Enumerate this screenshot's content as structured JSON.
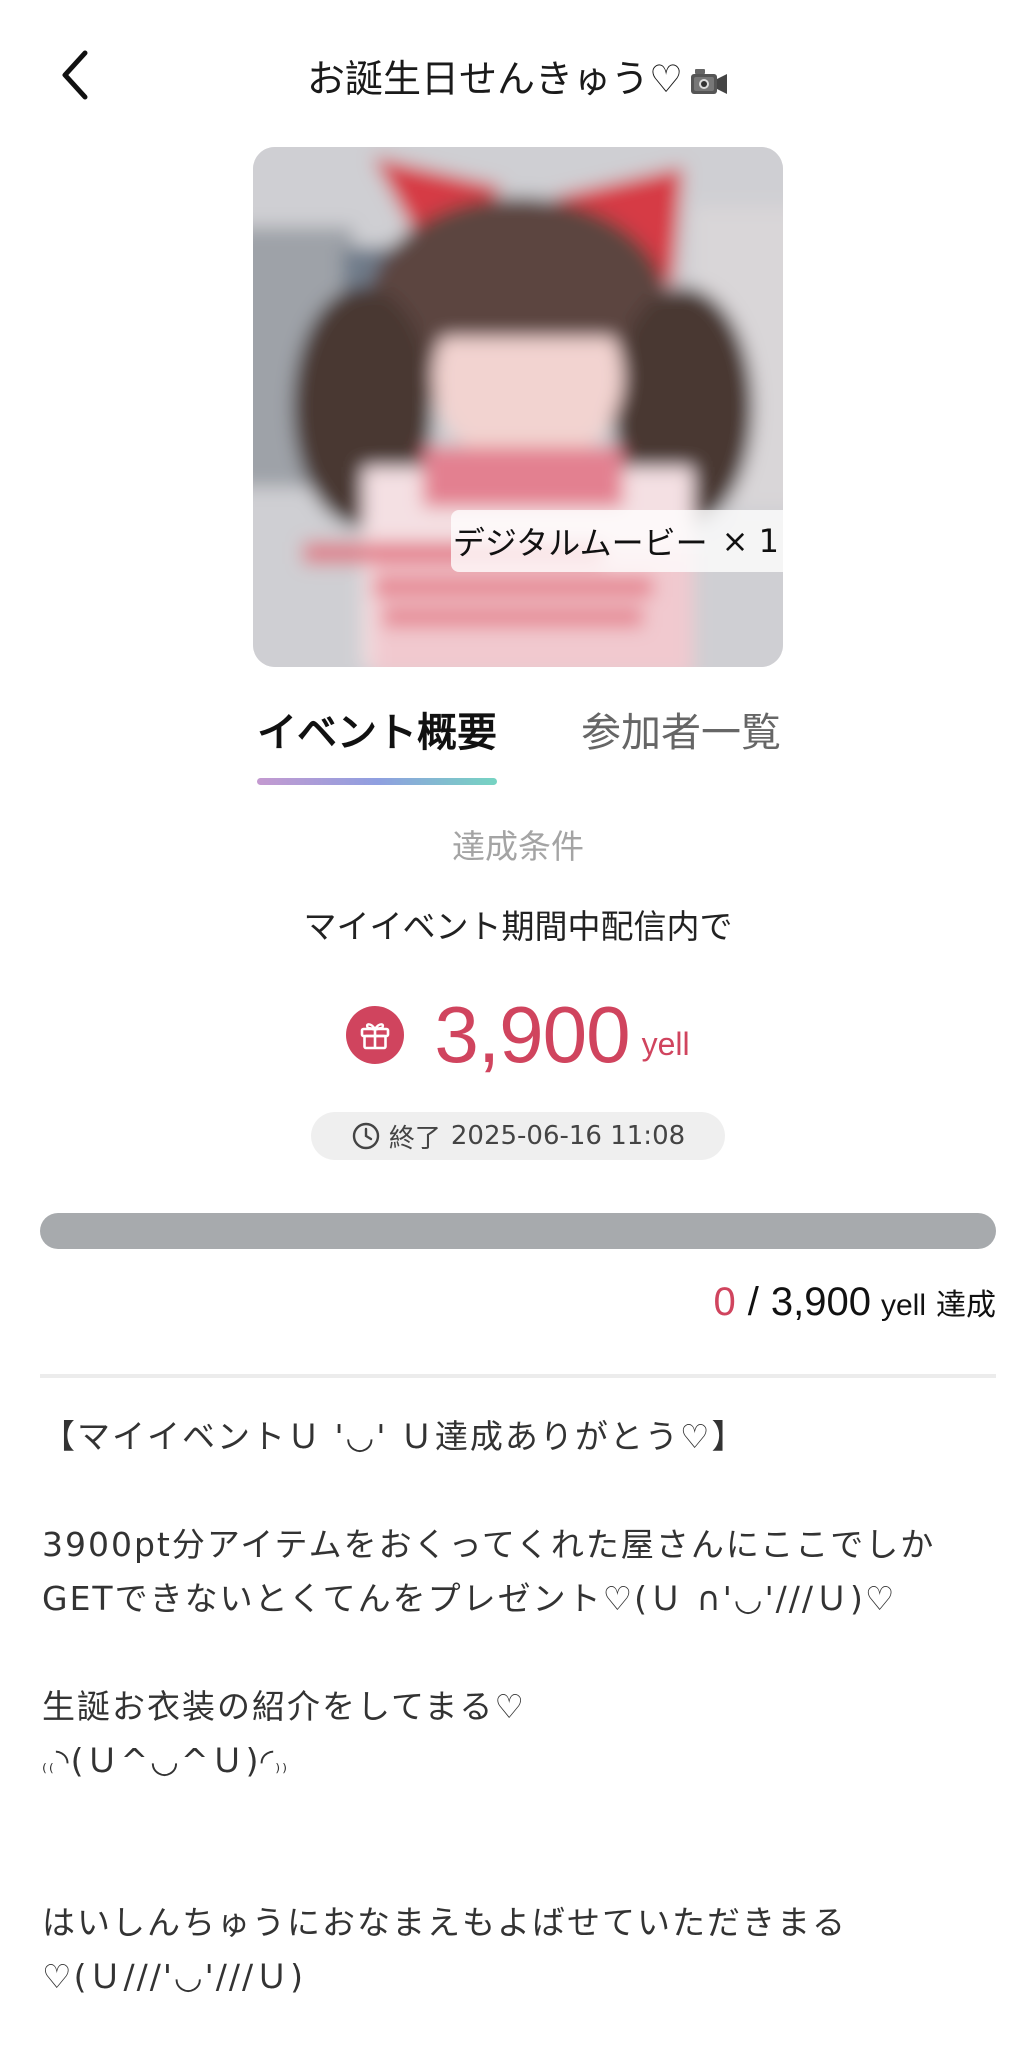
{
  "header": {
    "title": "お誕生日せんきゅう♡",
    "camera_icon": "video-camera-icon"
  },
  "hero": {
    "reward_label": "デジタルムービー",
    "reward_multiplier": "× 1"
  },
  "tabs": [
    {
      "label": "イベント概要",
      "active": true
    },
    {
      "label": "参加者一覧",
      "active": false
    }
  ],
  "condition": {
    "label": "達成条件",
    "text": "マイイベント期間中配信内で",
    "goal_value": "3,900",
    "goal_unit": "yell"
  },
  "end": {
    "word": "終了",
    "datetime": "2025-06-16 11:08"
  },
  "progress": {
    "current": "0",
    "separator": "/",
    "total": "3,900",
    "unit": "yell",
    "achieved_label": "達成",
    "fraction": 0
  },
  "description": {
    "line1": "【マイイベントＵ '◡' Ｕ達成ありがとう♡】",
    "line2": "3900pt分アイテムをおくってくれた屋さんにここでしか",
    "line3": "GETできないとくてんをプレゼント♡(Ｕ ∩'◡'///Ｕ)♡",
    "line4": "生誕お衣装の紹介をしてまる♡",
    "line5_a": "₍₍",
    "line5_b": "◝(Ｕ^◡^Ｕ)◜",
    "line5_c": "₎₎",
    "line6": "はいしんちゅうにおなまえもよばせていただきまる",
    "line7": "♡(Ｕ///'◡'///Ｕ)"
  },
  "colors": {
    "accent": "#d0445e",
    "progress_track": "#a7aaad",
    "tab_gradient": [
      "#c49ad0",
      "#8f9fe0",
      "#76d4c2"
    ]
  }
}
